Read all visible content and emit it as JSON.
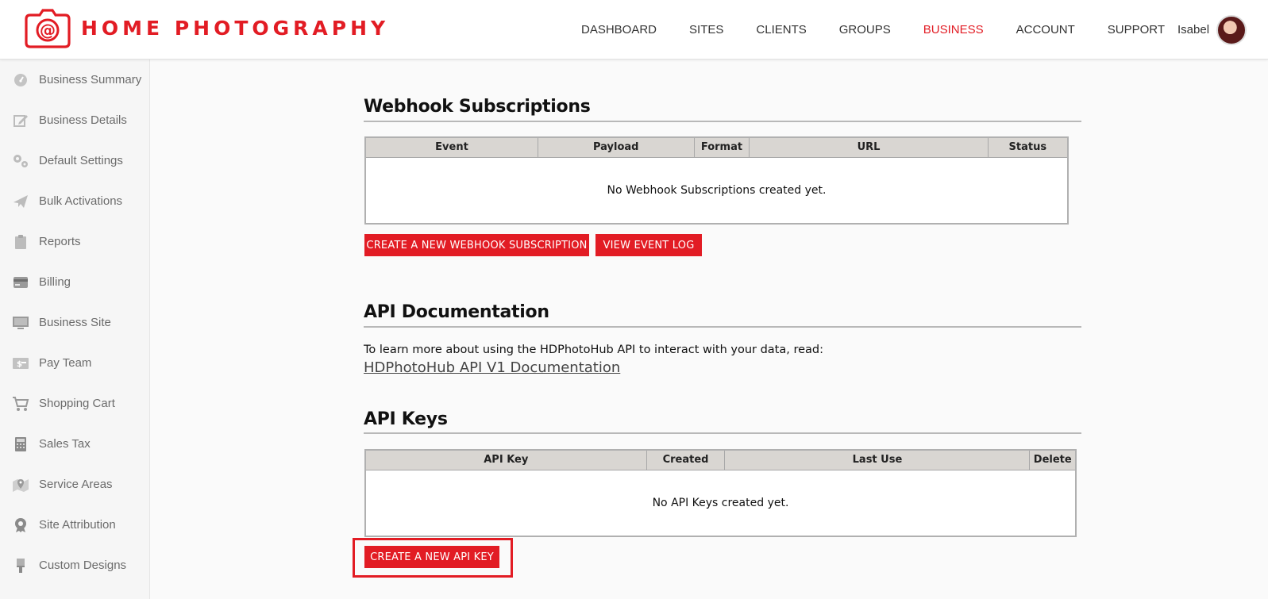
{
  "brand": {
    "name": "HOME PHOTOGRAPHY",
    "accent_color": "#e21c24"
  },
  "nav": {
    "items": [
      {
        "label": "DASHBOARD",
        "active": false
      },
      {
        "label": "SITES",
        "active": false
      },
      {
        "label": "CLIENTS",
        "active": false
      },
      {
        "label": "GROUPS",
        "active": false
      },
      {
        "label": "BUSINESS",
        "active": true
      },
      {
        "label": "ACCOUNT",
        "active": false
      },
      {
        "label": "SUPPORT",
        "active": false
      }
    ]
  },
  "user": {
    "name": "Isabel"
  },
  "sidebar": {
    "items": [
      {
        "label": "Business Summary",
        "icon": "gauge-icon"
      },
      {
        "label": "Business Details",
        "icon": "edit-icon"
      },
      {
        "label": "Default Settings",
        "icon": "gears-icon"
      },
      {
        "label": "Bulk Activations",
        "icon": "paper-plane-icon"
      },
      {
        "label": "Reports",
        "icon": "clipboard-icon"
      },
      {
        "label": "Billing",
        "icon": "credit-card-icon"
      },
      {
        "label": "Business Site",
        "icon": "monitor-icon"
      },
      {
        "label": "Pay Team",
        "icon": "money-icon"
      },
      {
        "label": "Shopping Cart",
        "icon": "cart-icon"
      },
      {
        "label": "Sales Tax",
        "icon": "calculator-icon"
      },
      {
        "label": "Service Areas",
        "icon": "map-pin-icon"
      },
      {
        "label": "Site Attribution",
        "icon": "award-icon"
      },
      {
        "label": "Custom Designs",
        "icon": "paint-brush-icon"
      }
    ]
  },
  "webhooks": {
    "title": "Webhook Subscriptions",
    "columns": [
      "Event",
      "Payload",
      "Format",
      "URL",
      "Status"
    ],
    "empty_text": "No Webhook Subscriptions created yet.",
    "create_button": "CREATE A NEW WEBHOOK SUBSCRIPTION",
    "log_button": "VIEW EVENT LOG"
  },
  "api_docs": {
    "title": "API Documentation",
    "text": "To learn more about using the HDPhotoHub API to interact with your data, read:",
    "link_label": "HDPhotoHub API V1 Documentation"
  },
  "api_keys": {
    "title": "API Keys",
    "columns": [
      "API Key",
      "Created",
      "Last Use",
      "Delete"
    ],
    "empty_text": "No API Keys created yet.",
    "create_button": "CREATE A NEW API KEY"
  }
}
